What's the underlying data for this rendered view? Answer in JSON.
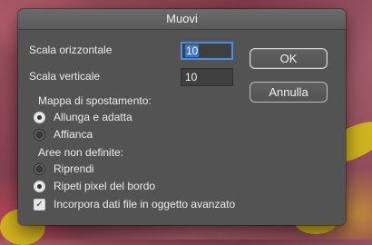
{
  "dialog": {
    "title": "Muovi",
    "horizontal_scale": {
      "label": "Scala orizzontale",
      "value": "10"
    },
    "vertical_scale": {
      "label": "Scala verticale",
      "value": "10"
    },
    "ok_label": "OK",
    "cancel_label": "Annulla",
    "displacement_map": {
      "heading": "Mappa di spostamento:",
      "options": [
        "Allunga e adatta",
        "Affianca"
      ],
      "selected": "Allunga e adatta"
    },
    "undefined_areas": {
      "heading": "Aree non definite:",
      "options": [
        "Riprendi",
        "Ripeti pixel del bordo"
      ],
      "selected": "Ripeti pixel del bordo"
    },
    "embed_checkbox": {
      "label": "Incorpora dati file in oggetto avanzato",
      "checked": true,
      "mark": "✓"
    }
  },
  "colors": {
    "dialog_bg": "#535353",
    "focus_accent": "#4a90e2",
    "background_yellow": "#d8c414"
  }
}
